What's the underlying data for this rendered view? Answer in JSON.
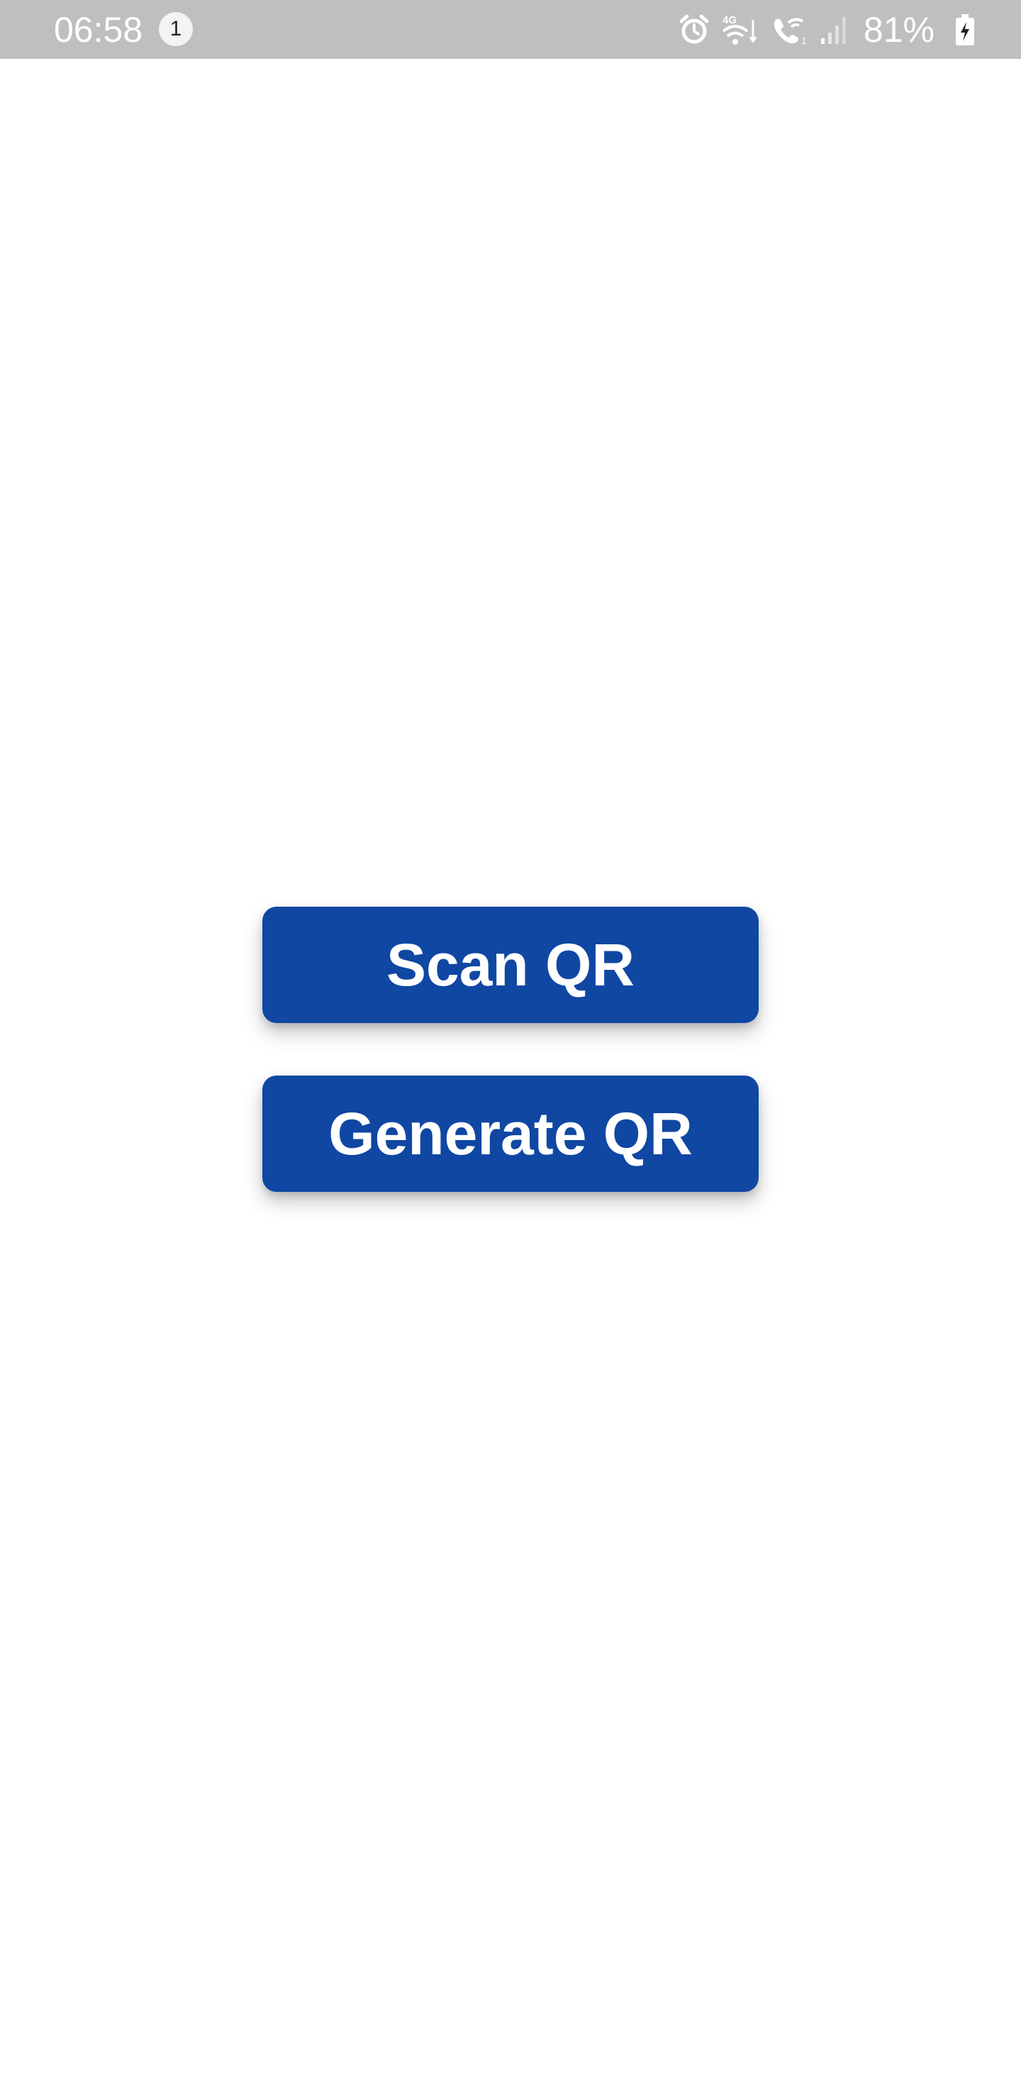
{
  "status_bar": {
    "time": "06:58",
    "notification_count": "1",
    "battery": "81%",
    "icons": [
      "alarm-icon",
      "wifi-4g-icon",
      "wifi-calling-icon",
      "signal-icon",
      "battery-charging-icon"
    ]
  },
  "main": {
    "scan_label": "Scan QR",
    "generate_label": "Generate QR"
  },
  "colors": {
    "button": "#0f47a3",
    "status_bar": "#bfbfbf"
  }
}
